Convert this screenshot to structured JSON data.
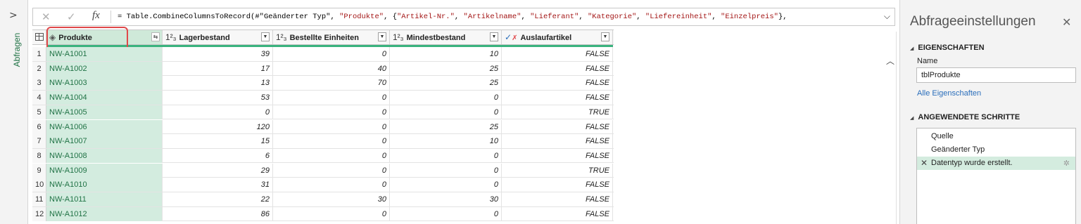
{
  "rail": {
    "expand_icon": "chevron-right-icon",
    "label": "Abfragen"
  },
  "formula_bar": {
    "cancel_icon": "close-icon",
    "confirm_icon": "check-icon",
    "fx_label": "fx",
    "formula_prefix": "= Table.CombineColumnsToRecord(#",
    "formula_parts": [
      {
        "t": "\"Geänderter Typ\"",
        "s": false
      },
      {
        "t": ", ",
        "s": false
      },
      {
        "t": "\"Produkte\"",
        "s": true
      },
      {
        "t": ", {",
        "s": false
      },
      {
        "t": "\"Artikel-Nr.\"",
        "s": true
      },
      {
        "t": ", ",
        "s": false
      },
      {
        "t": "\"Artikelname\"",
        "s": true
      },
      {
        "t": ", ",
        "s": false
      },
      {
        "t": "\"Lieferant\"",
        "s": true
      },
      {
        "t": ", ",
        "s": false
      },
      {
        "t": "\"Kategorie\"",
        "s": true
      },
      {
        "t": ", ",
        "s": false
      },
      {
        "t": "\"Liefereinheit\"",
        "s": true
      },
      {
        "t": ", ",
        "s": false
      },
      {
        "t": "\"Einzelpreis\"",
        "s": true
      },
      {
        "t": "},",
        "s": false
      }
    ],
    "expand_icon": "chevron-down-icon"
  },
  "table": {
    "columns": [
      {
        "name": "Produkte",
        "type_icon": "record-icon",
        "type_glyph": "◈"
      },
      {
        "name": "Lagerbestand",
        "type_icon": "whole-number-icon",
        "type_glyph": "1²₃"
      },
      {
        "name": "Bestellte Einheiten",
        "type_icon": "whole-number-icon",
        "type_glyph": "1²₃"
      },
      {
        "name": "Mindestbestand",
        "type_icon": "whole-number-icon",
        "type_glyph": "1²₃"
      },
      {
        "name": "Auslaufartikel",
        "type_icon": "logical-icon",
        "type_glyph": "✓✗"
      }
    ],
    "rows": [
      {
        "idx": "1",
        "produkte": "NW-A1001",
        "lager": "39",
        "bestellt": "0",
        "mindest": "10",
        "auslauf": "FALSE"
      },
      {
        "idx": "2",
        "produkte": "NW-A1002",
        "lager": "17",
        "bestellt": "40",
        "mindest": "25",
        "auslauf": "FALSE"
      },
      {
        "idx": "3",
        "produkte": "NW-A1003",
        "lager": "13",
        "bestellt": "70",
        "mindest": "25",
        "auslauf": "FALSE"
      },
      {
        "idx": "4",
        "produkte": "NW-A1004",
        "lager": "53",
        "bestellt": "0",
        "mindest": "0",
        "auslauf": "FALSE"
      },
      {
        "idx": "5",
        "produkte": "NW-A1005",
        "lager": "0",
        "bestellt": "0",
        "mindest": "0",
        "auslauf": "TRUE"
      },
      {
        "idx": "6",
        "produkte": "NW-A1006",
        "lager": "120",
        "bestellt": "0",
        "mindest": "25",
        "auslauf": "FALSE"
      },
      {
        "idx": "7",
        "produkte": "NW-A1007",
        "lager": "15",
        "bestellt": "0",
        "mindest": "10",
        "auslauf": "FALSE"
      },
      {
        "idx": "8",
        "produkte": "NW-A1008",
        "lager": "6",
        "bestellt": "0",
        "mindest": "0",
        "auslauf": "FALSE"
      },
      {
        "idx": "9",
        "produkte": "NW-A1009",
        "lager": "29",
        "bestellt": "0",
        "mindest": "0",
        "auslauf": "TRUE"
      },
      {
        "idx": "10",
        "produkte": "NW-A1010",
        "lager": "31",
        "bestellt": "0",
        "mindest": "0",
        "auslauf": "FALSE"
      },
      {
        "idx": "11",
        "produkte": "NW-A1011",
        "lager": "22",
        "bestellt": "30",
        "mindest": "30",
        "auslauf": "FALSE"
      },
      {
        "idx": "12",
        "produkte": "NW-A1012",
        "lager": "86",
        "bestellt": "0",
        "mindest": "0",
        "auslauf": "FALSE"
      }
    ],
    "scroll_up_icon": "chevron-up-icon"
  },
  "settings": {
    "title": "Abfrageeinstellungen",
    "close_icon": "close-icon",
    "properties_header": "EIGENSCHAFTEN",
    "name_label": "Name",
    "name_value": "tblProdukte",
    "all_properties_link": "Alle Eigenschaften",
    "steps_header": "ANGEWENDETE SCHRITTE",
    "steps": [
      {
        "label": "Quelle",
        "active": false
      },
      {
        "label": "Geänderter Typ",
        "active": false
      },
      {
        "label": "Datentyp wurde erstellt.",
        "active": true
      }
    ]
  },
  "colors": {
    "accent": "#217346",
    "selected_column": "#d3ecdf",
    "highlight_box": "#e0484a",
    "string_literal": "#a31515",
    "link": "#2a6ebb"
  }
}
